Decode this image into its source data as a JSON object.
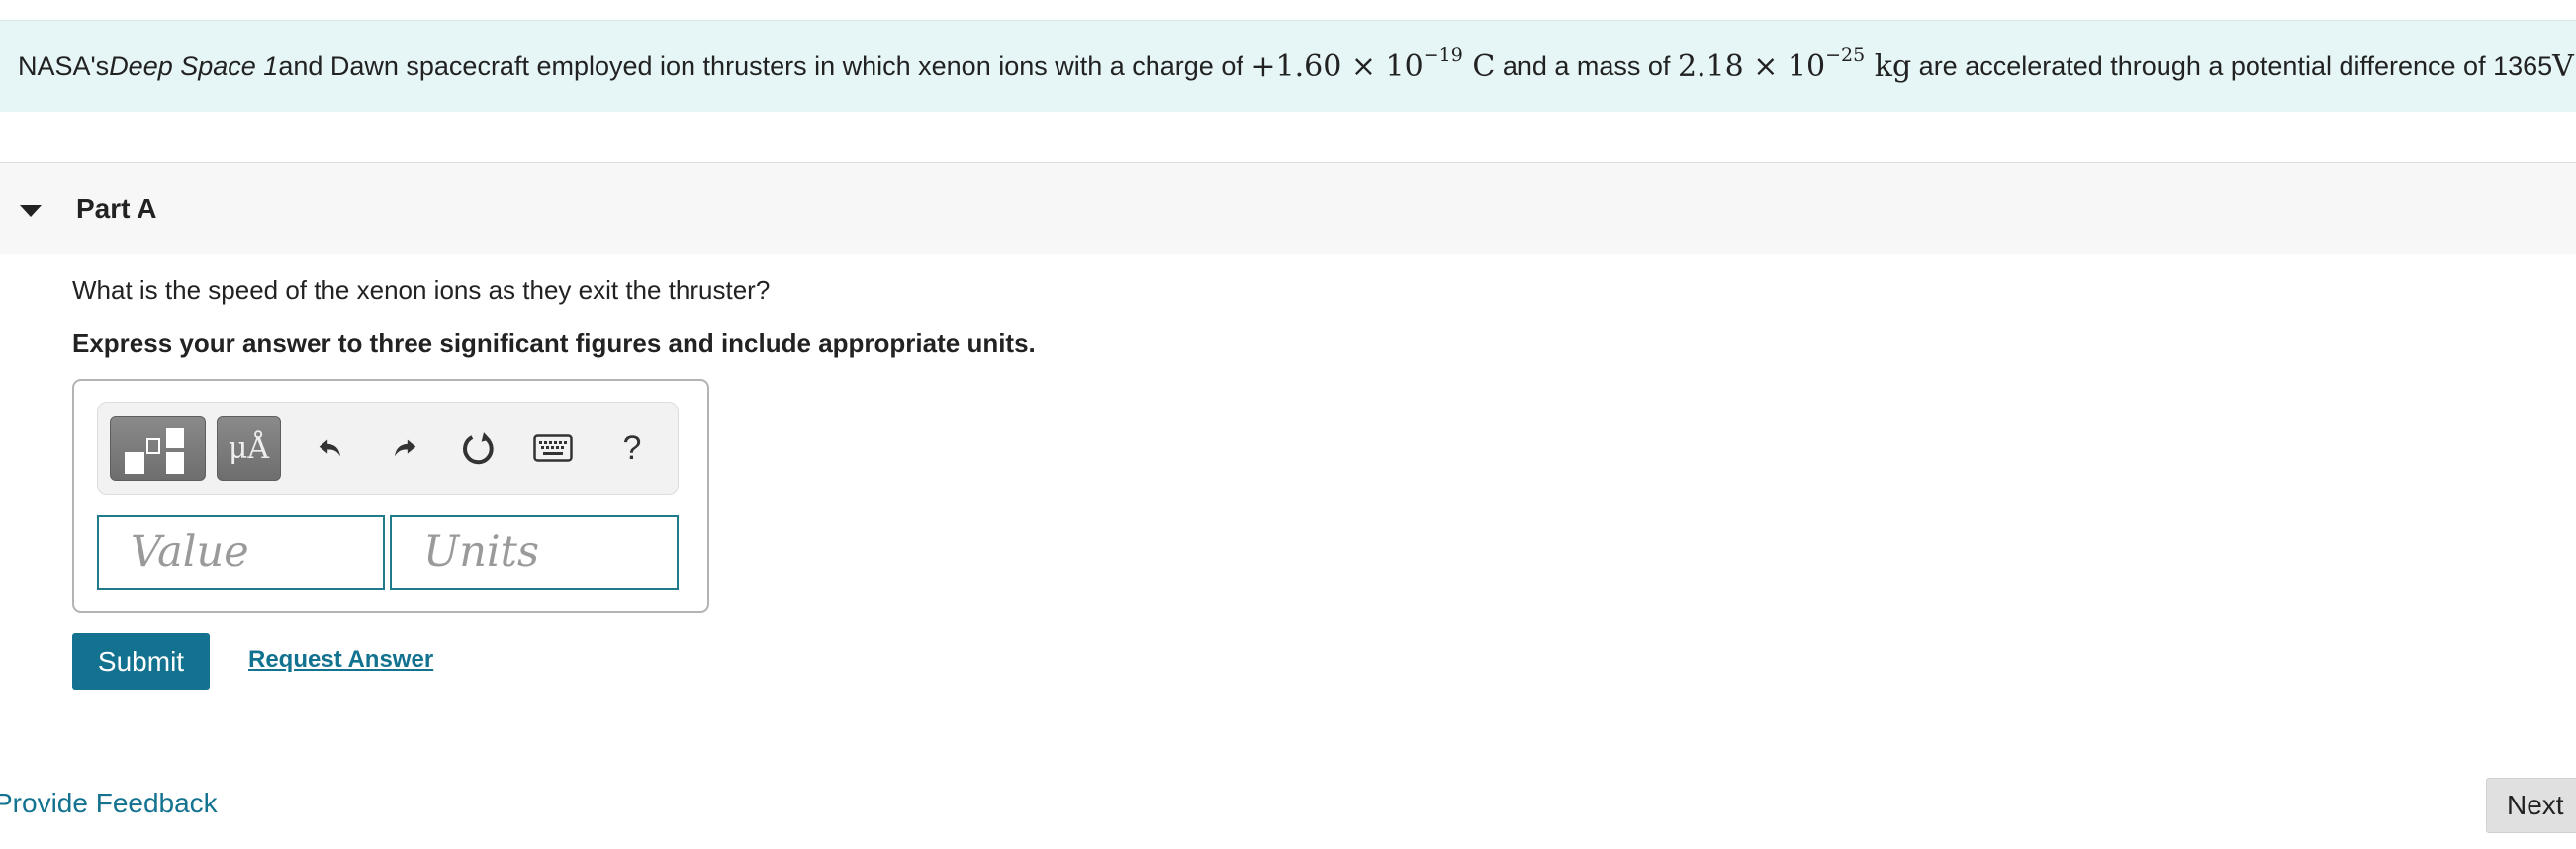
{
  "problem": {
    "part1": "NASA's ",
    "italic": "Deep Space 1",
    "part2": " and Dawn spacecraft employed ion thrusters in which xenon ions with a charge of ",
    "charge_mantissa": "+1.60 × 10",
    "charge_exp": "−19",
    "charge_unit": " C",
    "part3": " and a mass of ",
    "mass_mantissa": "2.18 × 10",
    "mass_exp": "−25",
    "mass_unit": " kg",
    "part4": " are accelerated through a potential difference of 1365 ",
    "voltage_unit": "V",
    "end": "."
  },
  "part": {
    "title": "Part A",
    "question": "What is the speed of the xenon ions as they exit the thruster?",
    "instruction": "Express your answer to three significant figures and include appropriate units."
  },
  "toolbar": {
    "units_label": "μÅ",
    "help_label": "?",
    "icons": [
      "templates-icon",
      "units-icon",
      "undo-icon",
      "redo-icon",
      "reset-icon",
      "keyboard-icon",
      "help-icon"
    ]
  },
  "answer": {
    "value_placeholder": "Value",
    "units_placeholder": "Units"
  },
  "actions": {
    "submit_label": "Submit",
    "request_label": "Request Answer",
    "feedback_label": "Provide Feedback",
    "next_label": "Next"
  },
  "colors": {
    "accent": "#13728f",
    "problem_bg": "#e6f5f6"
  }
}
